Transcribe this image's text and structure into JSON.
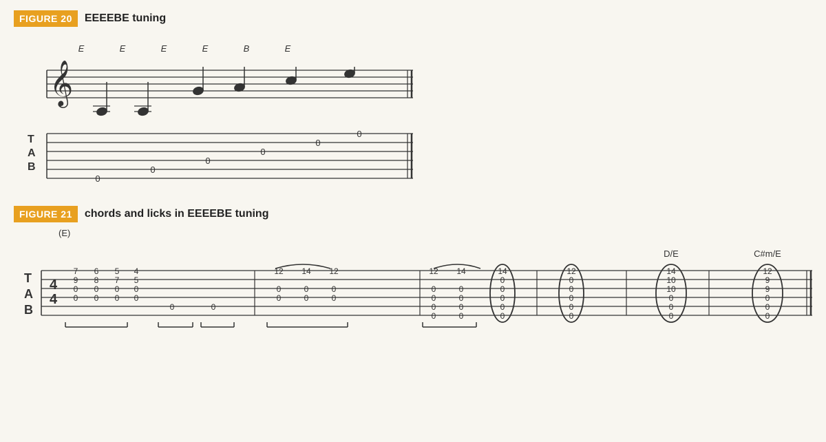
{
  "figure20": {
    "badge": "FIGURE 20",
    "title": "EEEEBE tuning",
    "string_labels": [
      "E",
      "E",
      "E",
      "E",
      "B",
      "E"
    ],
    "tab_numbers": {
      "string1": [
        "0"
      ],
      "string2": [
        "0"
      ],
      "string3": [
        "0"
      ],
      "string4": [
        "0"
      ],
      "string5": [
        "0"
      ],
      "string6": [
        "0"
      ]
    }
  },
  "figure21": {
    "badge": "FIGURE 21",
    "title": "chords and licks in EEEEBE tuning",
    "chord_label": "(E)",
    "chord_labels_right": [
      "D/E",
      "C#m/E"
    ]
  }
}
